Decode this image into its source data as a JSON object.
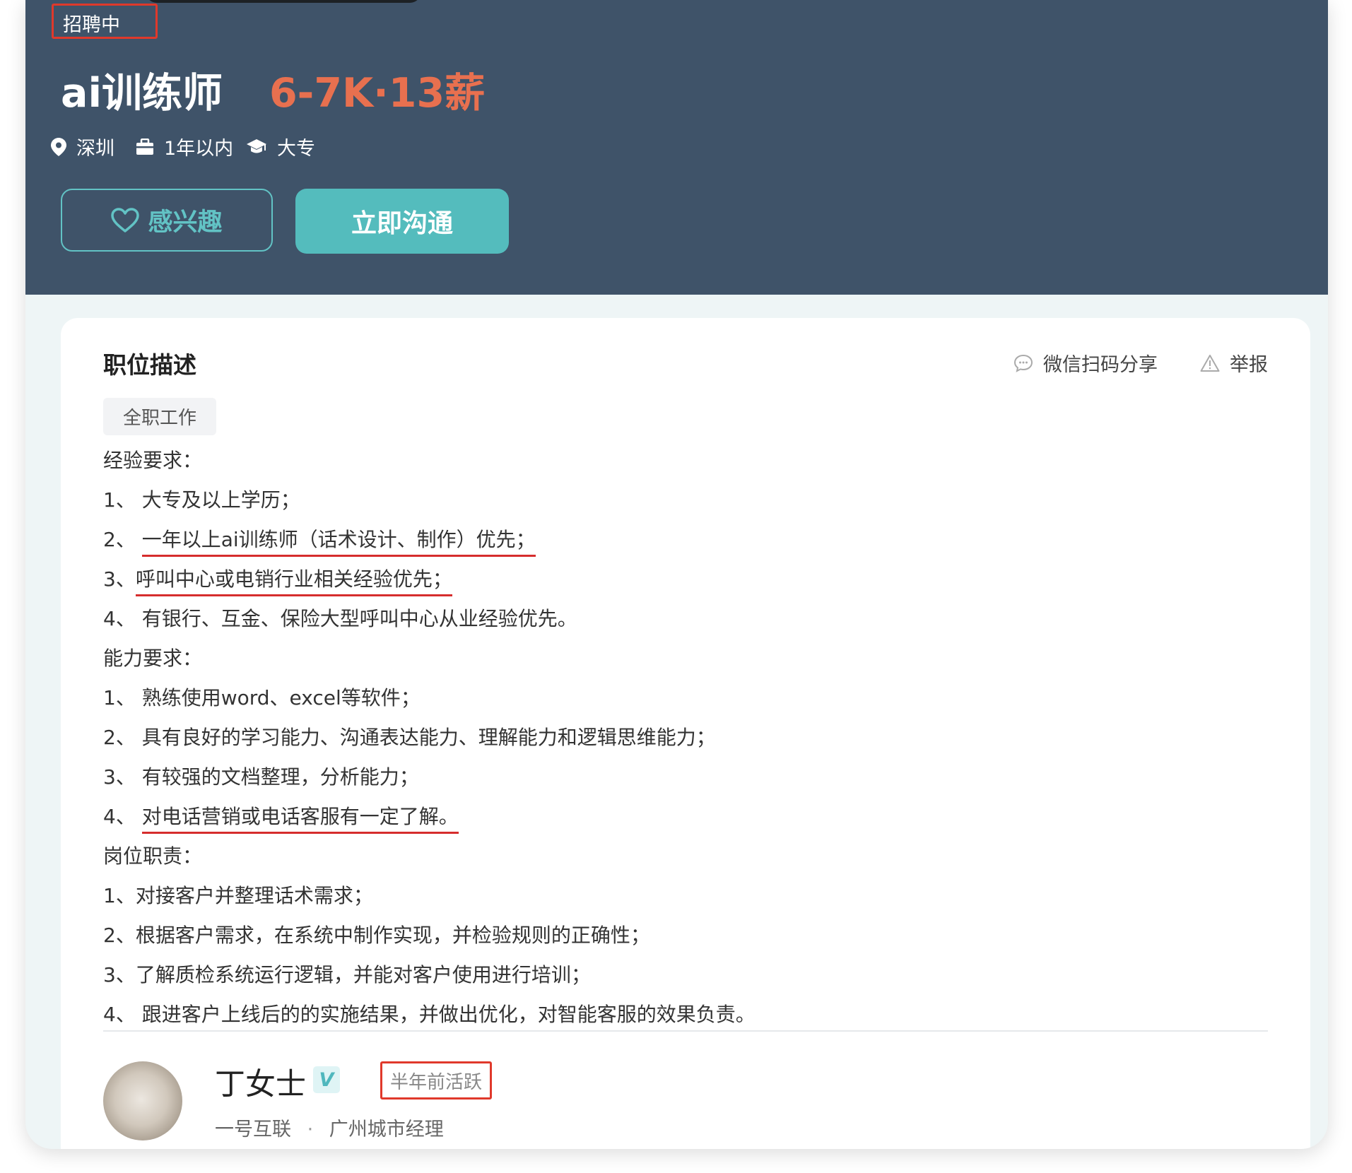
{
  "job": {
    "status": "招聘中",
    "title": "ai训练师",
    "salary": "6-7K·13薪",
    "location": "深圳",
    "experience": "1年以内",
    "education": "大专"
  },
  "actions": {
    "interest_label": "感兴趣",
    "chat_label": "立即沟通"
  },
  "description": {
    "section_title": "职位描述",
    "share_label": "微信扫码分享",
    "report_label": "举报",
    "job_type_tag": "全职工作",
    "lines": [
      "经验要求：",
      "1、 大专及以上学历；",
      "2、 ",
      "一年以上ai训练师（话术设计、制作）优先；",
      "3、",
      "呼叫中心或电销行业相关经验优先；",
      "4、 有银行、互金、保险大型呼叫中心从业经验优先。",
      "能力要求：",
      "1、 熟练使用word、excel等软件；",
      "2、 具有良好的学习能力、沟通表达能力、理解能力和逻辑思维能力；",
      "3、 有较强的文档整理，分析能力；",
      "4、 ",
      "对电话营销或电话客服有一定了解。",
      "岗位职责：",
      "1、对接客户并整理话术需求；",
      "2、根据客户需求，在系统中制作实现，并检验规则的正确性；",
      "3、了解质检系统运行逻辑，并能对客户使用进行培训；",
      "4、 跟进客户上线后的的实施结果，并做出优化，对智能客服的效果负责。"
    ]
  },
  "recruiter": {
    "name": "丁女士",
    "verified_badge": "V",
    "active_status": "半年前活跃",
    "company": "一号互联",
    "separator": "·",
    "position": "广州城市经理"
  },
  "colors": {
    "header_bg": "#3f5369",
    "salary": "#e8704f",
    "accent_teal": "#54bcbd",
    "annotation_red": "#e0392b"
  },
  "icons": [
    "location-pin-icon",
    "briefcase-icon",
    "graduation-cap-icon",
    "heart-icon",
    "chat-bubble-icon",
    "warning-triangle-icon"
  ]
}
